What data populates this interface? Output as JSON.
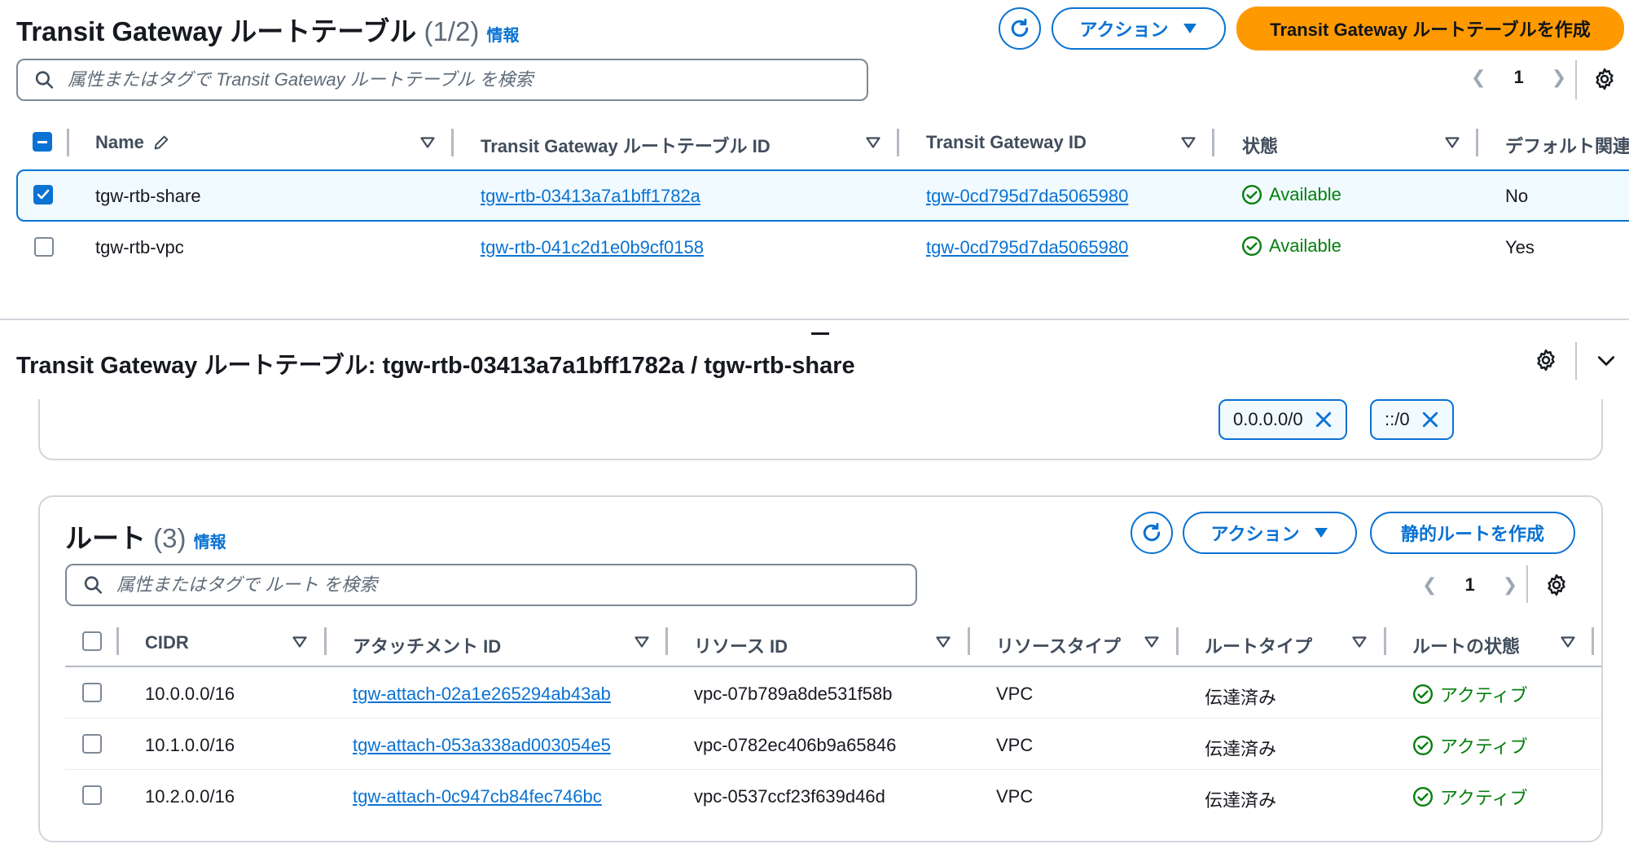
{
  "top": {
    "title": "Transit Gateway ルートテーブル",
    "count": "(1/2)",
    "info": "情報",
    "actions_label": "アクション",
    "create_label": "Transit Gateway ルートテーブルを作成",
    "search_placeholder": "属性またはタグで Transit Gateway ルートテーブル を検索",
    "page": "1",
    "columns": [
      "Name",
      "Transit Gateway ルートテーブル ID",
      "Transit Gateway ID",
      "状態",
      "デフォルト関連"
    ],
    "rows": [
      {
        "name": "tgw-rtb-share",
        "rtb_id": "tgw-rtb-03413a7a1bff1782a",
        "tgw_id": "tgw-0cd795d7da5065980",
        "status": "Available",
        "default": "No",
        "selected": true
      },
      {
        "name": "tgw-rtb-vpc",
        "rtb_id": "tgw-rtb-041c2d1e0b9cf0158",
        "tgw_id": "tgw-0cd795d7da5065980",
        "status": "Available",
        "default": "Yes",
        "selected": false
      }
    ]
  },
  "detail": {
    "title": "Transit Gateway ルートテーブル: tgw-rtb-03413a7a1bff1782a / tgw-rtb-share",
    "tokens": [
      "0.0.0.0/0",
      "::/0"
    ]
  },
  "routes": {
    "title": "ルート",
    "count": "(3)",
    "info": "情報",
    "actions_label": "アクション",
    "create_label": "静的ルートを作成",
    "search_placeholder": "属性またはタグで ルート を検索",
    "page": "1",
    "columns": [
      "CIDR",
      "アタッチメント ID",
      "リソース ID",
      "リソースタイプ",
      "ルートタイプ",
      "ルートの状態"
    ],
    "rows": [
      {
        "cidr": "10.0.0.0/16",
        "attach": "tgw-attach-02a1e265294ab43ab",
        "resource": "vpc-07b789a8de531f58b",
        "rtype": "VPC",
        "route_type": "伝達済み",
        "state": "アクティブ"
      },
      {
        "cidr": "10.1.0.0/16",
        "attach": "tgw-attach-053a338ad003054e5",
        "resource": "vpc-0782ec406b9a65846",
        "rtype": "VPC",
        "route_type": "伝達済み",
        "state": "アクティブ"
      },
      {
        "cidr": "10.2.0.0/16",
        "attach": "tgw-attach-0c947cb84fec746bc",
        "resource": "vpc-0537ccf23f639d46d",
        "rtype": "VPC",
        "route_type": "伝達済み",
        "state": "アクティブ"
      }
    ]
  },
  "colors": {
    "accent": "#0972d3",
    "primary": "#ff9900",
    "success": "#037f0c"
  }
}
